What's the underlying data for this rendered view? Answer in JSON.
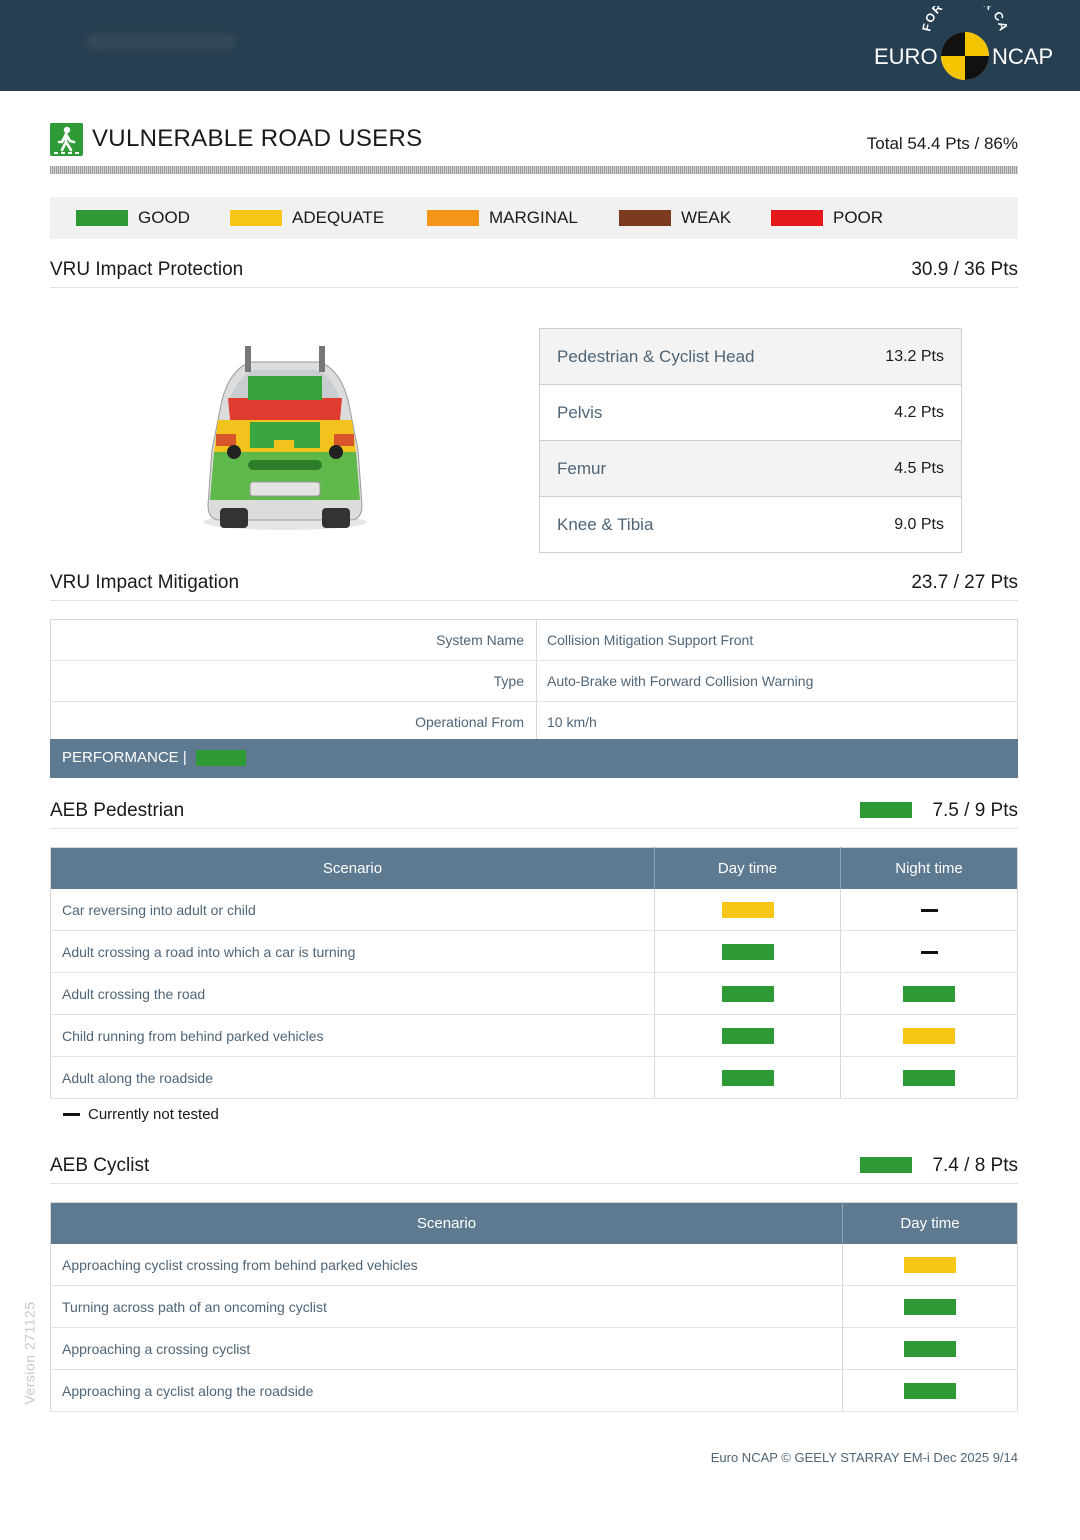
{
  "colors": {
    "good": "#2e9a35",
    "adequate": "#f8c616",
    "marginal": "#f49419",
    "weak": "#7c3b20",
    "poor": "#e4171b",
    "header_bar": "#273f52",
    "table_header": "#5e7a91"
  },
  "header": {
    "logo_text_left": "EURO",
    "logo_text_right": "NCAP",
    "logo_arc": "FOR SAFER CARS"
  },
  "section": {
    "icon": "pedestrian-icon",
    "title": "VULNERABLE ROAD USERS",
    "total": "Total 54.4 Pts / 86%"
  },
  "legend": [
    {
      "label": "GOOD",
      "color": "#2e9a35"
    },
    {
      "label": "ADEQUATE",
      "color": "#f8c616"
    },
    {
      "label": "MARGINAL",
      "color": "#f49419"
    },
    {
      "label": "WEAK",
      "color": "#7c3b20"
    },
    {
      "label": "POOR",
      "color": "#e4171b"
    }
  ],
  "impact_protection": {
    "title": "VRU Impact Protection",
    "points": "30.9 / 36 Pts",
    "rows": [
      {
        "label": "Pedestrian & Cyclist Head",
        "value": "13.2 Pts"
      },
      {
        "label": "Pelvis",
        "value": "4.2 Pts"
      },
      {
        "label": "Femur",
        "value": "4.5 Pts"
      },
      {
        "label": "Knee & Tibia",
        "value": "9.0 Pts"
      }
    ]
  },
  "impact_mitigation": {
    "title": "VRU Impact Mitigation",
    "points": "23.7 / 27 Pts",
    "rows": [
      {
        "key": "System Name",
        "value": "Collision Mitigation Support Front"
      },
      {
        "key": "Type",
        "value": "Auto-Brake with Forward Collision Warning"
      },
      {
        "key": "Operational From",
        "value": "10 km/h"
      }
    ],
    "performance_label": "PERFORMANCE |",
    "performance_rating": "good"
  },
  "aeb_pedestrian": {
    "title": "AEB Pedestrian",
    "points": "7.5 / 9 Pts",
    "rating": "good",
    "headers": [
      "Scenario",
      "Day time",
      "Night time"
    ],
    "rows": [
      {
        "scenario": "Car reversing into adult or child",
        "day": "adequate",
        "night": "not_tested"
      },
      {
        "scenario": "Adult crossing a road into which a car is turning",
        "day": "good",
        "night": "not_tested"
      },
      {
        "scenario": "Adult crossing the road",
        "day": "good",
        "night": "good"
      },
      {
        "scenario": "Child running from behind parked vehicles",
        "day": "good",
        "night": "adequate"
      },
      {
        "scenario": "Adult along the roadside",
        "day": "good",
        "night": "good"
      }
    ],
    "note": "Currently not tested"
  },
  "aeb_cyclist": {
    "title": "AEB Cyclist",
    "points": "7.4 / 8 Pts",
    "rating": "good",
    "headers": [
      "Scenario",
      "Day time"
    ],
    "rows": [
      {
        "scenario": "Approaching cyclist crossing from behind parked vehicles",
        "day": "adequate"
      },
      {
        "scenario": "Turning across path of an oncoming cyclist",
        "day": "good"
      },
      {
        "scenario": "Approaching a crossing cyclist",
        "day": "good"
      },
      {
        "scenario": "Approaching a cyclist along the roadside",
        "day": "good"
      }
    ]
  },
  "footer": "Euro NCAP © GEELY STARRAY EM-i Dec 2025 9/14",
  "version": "Version 271125"
}
